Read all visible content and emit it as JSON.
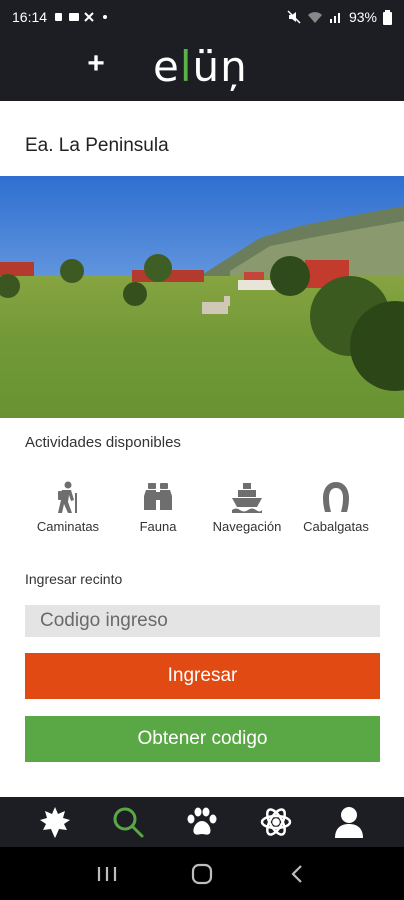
{
  "status": {
    "time": "16:14",
    "battery": "93%"
  },
  "header": {
    "plus_symbol": "+",
    "logo_pre": "e",
    "logo_l": "l",
    "logo_post": "üņ"
  },
  "place": {
    "title": "Ea. La Peninsula"
  },
  "activities": {
    "heading": "Actividades disponibles",
    "items": [
      {
        "label": "Caminatas",
        "icon": "hiker-icon"
      },
      {
        "label": "Fauna",
        "icon": "binoculars-icon"
      },
      {
        "label": "Navegación",
        "icon": "ship-icon"
      },
      {
        "label": "Cabalgatas",
        "icon": "horseshoe-icon"
      }
    ]
  },
  "access": {
    "heading": "Ingresar recinto",
    "placeholder": "Codigo ingreso",
    "submit_label": "Ingresar",
    "get_code_label": "Obtener codigo"
  },
  "nav": {
    "items": [
      "leaf-icon",
      "search-icon",
      "paw-icon",
      "atom-icon",
      "user-icon"
    ],
    "active": "search-icon",
    "active_color": "#5aa845",
    "inactive_color": "#ffffff"
  },
  "colors": {
    "dark_bar": "#1c1e24",
    "orange": "#e24a14",
    "green": "#5aa845"
  }
}
